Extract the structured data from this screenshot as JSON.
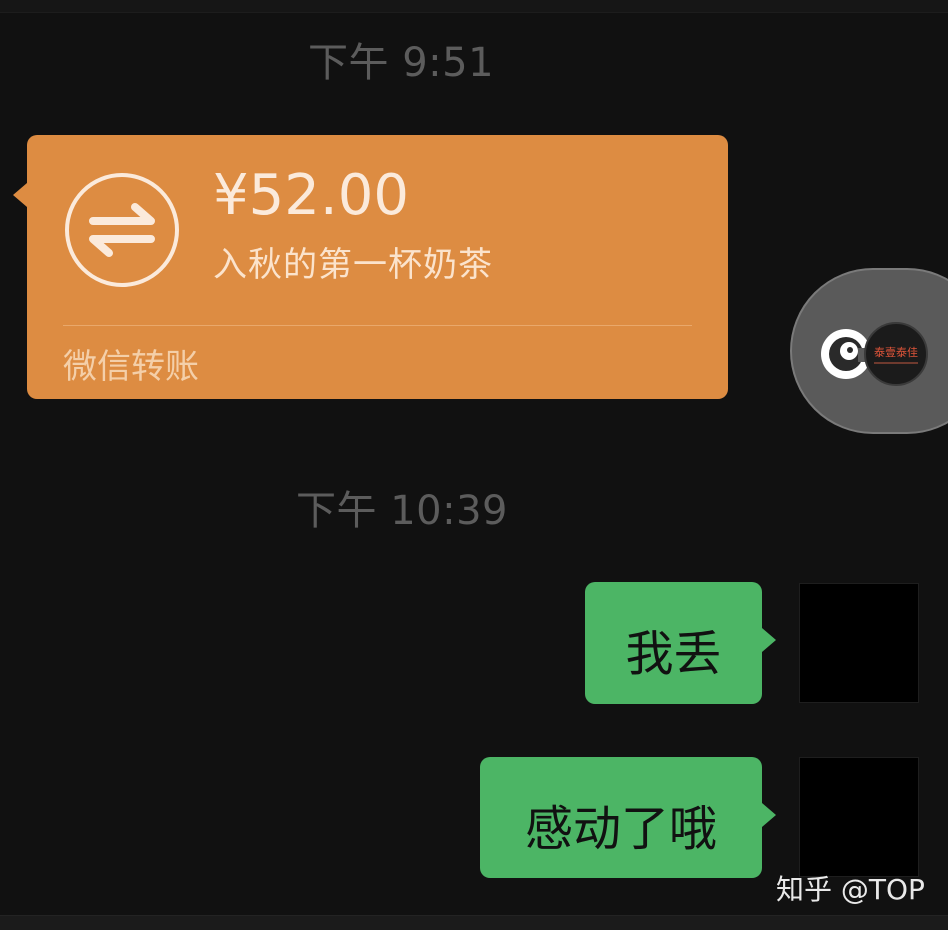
{
  "timestamps": {
    "first": "下午 9:51",
    "second": "下午 10:39"
  },
  "transfer": {
    "amount": "¥52.00",
    "remark": "入秋的第一杯奶茶",
    "footer": "微信转账",
    "icon": "transfer-arrows-icon",
    "color": "#dd8c42"
  },
  "floating_capsule": {
    "app_icon": "camera-c-app-icon",
    "avatar_text": "泰壹泰佳"
  },
  "messages": [
    {
      "text": "我丢",
      "sender": "self"
    },
    {
      "text": "感动了哦",
      "sender": "self"
    }
  ],
  "bubble_color": "#4cb565",
  "watermark": "知乎 @TOP"
}
